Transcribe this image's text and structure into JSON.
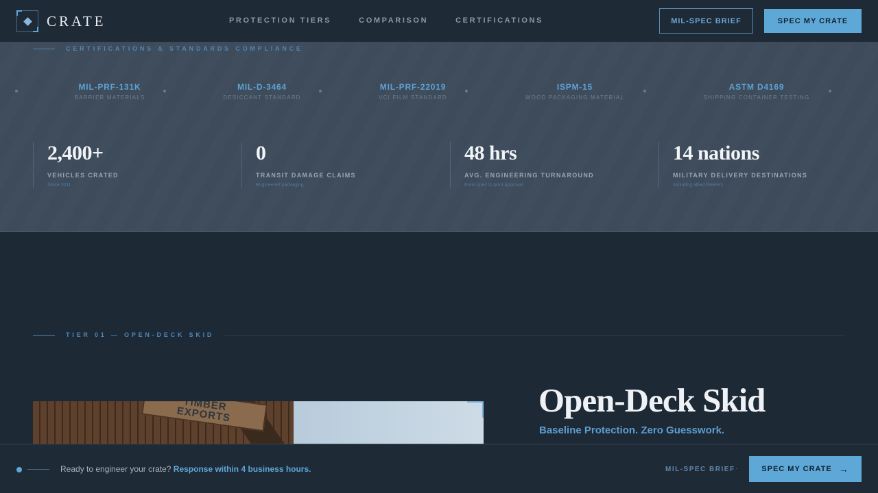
{
  "header": {
    "logo_text": "CRATE",
    "nav": [
      "PROTECTION TIERS",
      "COMPARISON",
      "CERTIFICATIONS"
    ],
    "brief_label": "MIL-SPEC BRIEF",
    "spec_label": "SPEC MY CRATE"
  },
  "certifications": {
    "eyebrow": "CERTIFICATIONS & STANDARDS COMPLIANCE",
    "items": [
      {
        "code": "MIL-PRF-131K",
        "desc": "BARRIER MATERIALS"
      },
      {
        "code": "MIL-D-3464",
        "desc": "DESICCANT STANDARD"
      },
      {
        "code": "MIL-PRF-22019",
        "desc": "VCI FILM STANDARD"
      },
      {
        "code": "ISPM-15",
        "desc": "WOOD PACKAGING MATERIAL"
      },
      {
        "code": "ASTM D4169",
        "desc": "SHIPPING CONTAINER TESTING"
      }
    ]
  },
  "stats": [
    {
      "value": "2,400+",
      "label": "VEHICLES CRATED",
      "note": "Since 2011"
    },
    {
      "value": "0",
      "label": "TRANSIT DAMAGE CLAIMS",
      "note": "Engineered packaging"
    },
    {
      "value": "48 hrs",
      "label": "AVG. ENGINEERING TURNAROUND",
      "note": "From spec to print approval"
    },
    {
      "value": "14 nations",
      "label": "MILITARY DELIVERY DESTINATIONS",
      "note": "Including allied theaters"
    }
  ],
  "tier": {
    "eyebrow": "TIER 01 — OPEN-DECK SKID",
    "title": "Open-Deck Skid",
    "subtitle": "Baseline Protection. Zero Guesswork.",
    "photo_sign": [
      "TIMBER",
      "EXPORTS"
    ]
  },
  "bottom_bar": {
    "prompt": "Ready to engineer your crate?",
    "highlight": "Response within 4 business hours.",
    "brief_label": "MIL-SPEC BRIEF",
    "separator": "·",
    "spec_label": "SPEC MY CRATE",
    "arrow": "→"
  },
  "colors": {
    "accent": "#5ea8d8",
    "background": "#1e2936",
    "band": "#3e4c5c"
  }
}
